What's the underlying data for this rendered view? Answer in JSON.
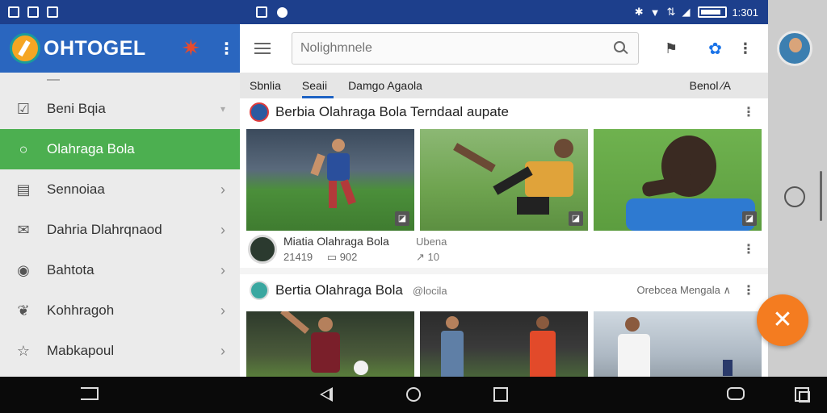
{
  "status_bar": {
    "time": "1:301"
  },
  "app": {
    "brand": "OHTOGEL"
  },
  "drawer": {
    "items": [
      {
        "label": "Beni Bqia",
        "icon": "clipboard-check-icon",
        "active": false,
        "chevron": false
      },
      {
        "label": "Olahraga Bola",
        "icon": "search-icon",
        "active": true,
        "chevron": false
      },
      {
        "label": "Sennoiaa",
        "icon": "news-icon",
        "active": false,
        "chevron": true
      },
      {
        "label": "Dahria Dlahrqnaod",
        "icon": "mail-icon",
        "active": false,
        "chevron": true
      },
      {
        "label": "Bahtota",
        "icon": "record-icon",
        "active": false,
        "chevron": true
      },
      {
        "label": "Kohhragoh",
        "icon": "leaf-icon",
        "active": false,
        "chevron": true
      },
      {
        "label": "Mabkapoul",
        "icon": "star-check-icon",
        "active": false,
        "chevron": true
      }
    ]
  },
  "search": {
    "placeholder": "Nolighmnele"
  },
  "tabs": {
    "items": [
      "Sbnlia",
      "Seaii",
      "Damgo Agaola"
    ],
    "selected_index": 1,
    "right_label": "Benol ⁄A"
  },
  "cards": [
    {
      "title": "Berbia Olahraga Bola Terndaal aupate",
      "meta": {
        "name": "Miatia Olahraga Bola",
        "views": "21419",
        "count": "902",
        "label": "Ubena",
        "share": "10"
      }
    },
    {
      "title": "Bertia Olahraga Bola",
      "subtitle": "@locila",
      "right": "Orebcea Mengala"
    }
  ],
  "colors": {
    "status_bar": "#1d3f8c",
    "brand_bar": "#2a66bf",
    "active_nav": "#4caf50",
    "fab": "#f47c20",
    "tab_indicator": "#1e63c4"
  }
}
